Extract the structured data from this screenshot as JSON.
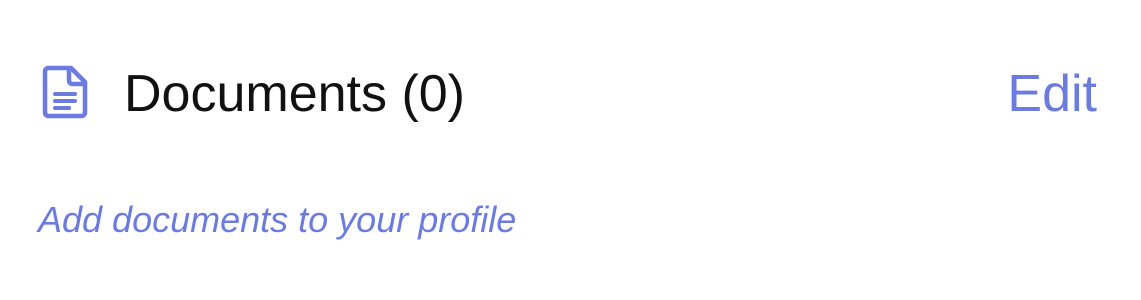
{
  "documents_section": {
    "icon": "document-icon",
    "title": "Documents (0)",
    "edit_label": "Edit",
    "empty_prompt": "Add documents to your profile"
  },
  "colors": {
    "accent": "#6b7be0",
    "title_text": "#111111",
    "background": "#ffffff"
  }
}
